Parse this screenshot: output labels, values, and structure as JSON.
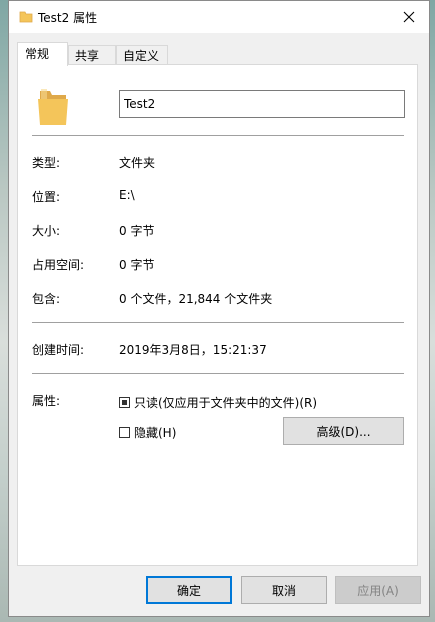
{
  "window": {
    "title": "Test2 属性"
  },
  "tabs": [
    {
      "label": "常规",
      "active": true
    },
    {
      "label": "共享",
      "active": false
    },
    {
      "label": "自定义",
      "active": false
    }
  ],
  "general": {
    "name_value": "Test2",
    "rows": {
      "type": {
        "label": "类型:",
        "value": "文件夹"
      },
      "location": {
        "label": "位置:",
        "value": "E:\\"
      },
      "size": {
        "label": "大小:",
        "value": "0 字节"
      },
      "size_on_disk": {
        "label": "占用空间:",
        "value": "0 字节"
      },
      "contains": {
        "label": "包含:",
        "value": "0 个文件，21,844 个文件夹"
      },
      "created": {
        "label": "创建时间:",
        "value": "2019年3月8日，15:21:37"
      }
    },
    "attributes": {
      "label": "属性:",
      "readonly_label": "只读(仅应用于文件夹中的文件)(R)",
      "readonly_state": "indeterminate",
      "hidden_label": "隐藏(H)",
      "hidden_state": "unchecked",
      "advanced_button": "高级(D)..."
    }
  },
  "footer": {
    "ok": "确定",
    "cancel": "取消",
    "apply": "应用(A)"
  },
  "colors": {
    "folder_yellow": "#f4c55a",
    "folder_dark": "#dfa94a",
    "default_button_border": "#0078d7"
  },
  "icons": {
    "title_icon": "folder-icon",
    "big_icon": "folder-icon",
    "close": "close-icon"
  }
}
